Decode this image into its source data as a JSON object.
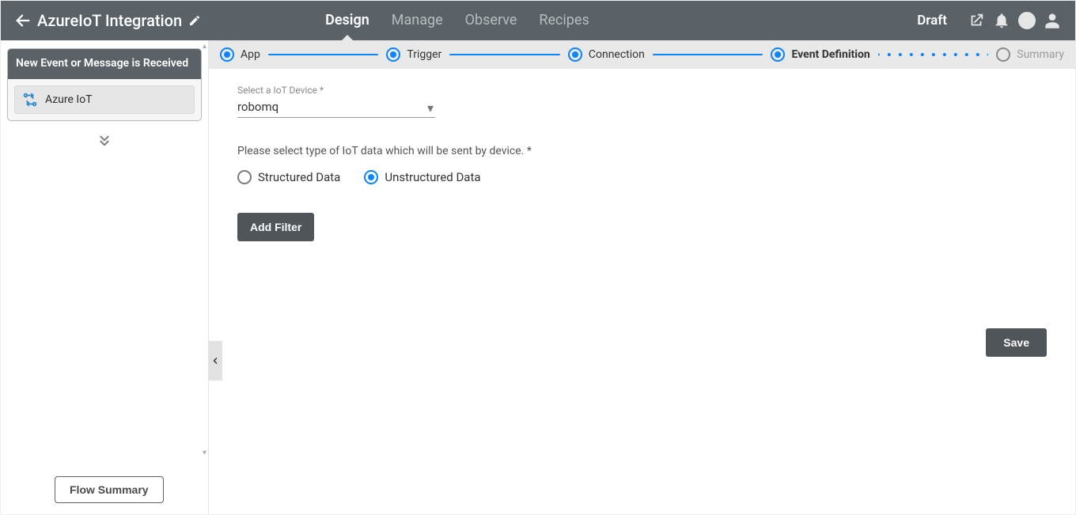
{
  "header": {
    "title": "AzureIoT Integration",
    "nav": {
      "design": "Design",
      "manage": "Manage",
      "observe": "Observe",
      "recipes": "Recipes"
    },
    "status": "Draft"
  },
  "sidebar": {
    "card_title": "New Event or Message is Received",
    "node_label": "Azure IoT",
    "flow_summary_btn": "Flow Summary"
  },
  "steps": {
    "app": "App",
    "trigger": "Trigger",
    "connection": "Connection",
    "event_def": "Event Definition",
    "summary": "Summary"
  },
  "form": {
    "device_label": "Select a IoT Device *",
    "device_value": "robomq",
    "type_hint": "Please select type of IoT data which will be sent by device. *",
    "radio_structured": "Structured Data",
    "radio_unstructured": "Unstructured Data",
    "add_filter_btn": "Add Filter",
    "save_btn": "Save"
  }
}
